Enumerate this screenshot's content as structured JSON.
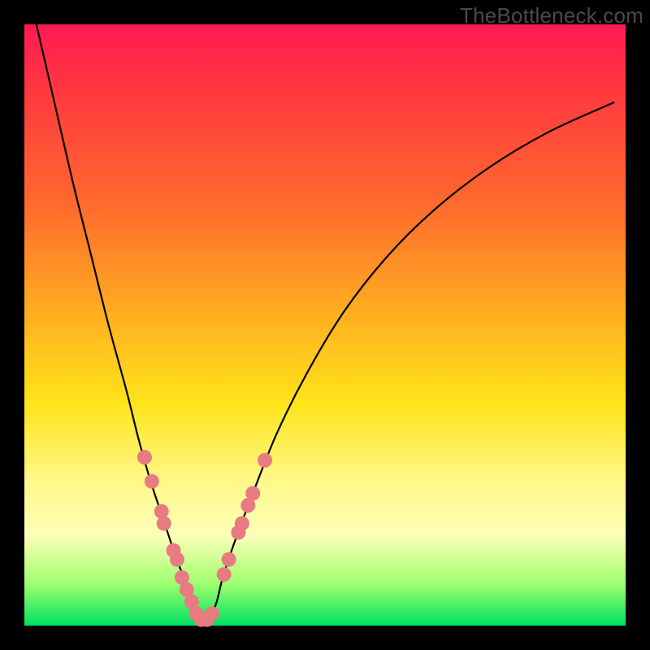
{
  "watermark": "TheBottleneck.com",
  "chart_data": {
    "type": "line",
    "title": "",
    "xlabel": "",
    "ylabel": "",
    "xlim": [
      0,
      100
    ],
    "ylim": [
      0,
      100
    ],
    "grid": false,
    "legend": false,
    "series": [
      {
        "name": "bottleneck-curve",
        "x": [
          2,
          5,
          8,
          11,
          14,
          17,
          19,
          21,
          23,
          25,
          26.5,
          28,
          29,
          30,
          31,
          32,
          33,
          35,
          38,
          42,
          47,
          53,
          60,
          68,
          77,
          87,
          98
        ],
        "y": [
          100,
          87,
          74,
          62,
          50,
          39,
          31,
          24,
          18,
          12,
          8,
          4,
          1.5,
          0,
          1.5,
          4,
          8,
          14,
          22,
          32,
          42,
          52,
          61,
          69,
          76,
          82,
          87
        ]
      }
    ],
    "markers": {
      "name": "highlight-points",
      "color": "#e87a82",
      "radius_px": 9,
      "points": [
        {
          "x": 20.0,
          "y": 28.0
        },
        {
          "x": 21.2,
          "y": 24.0
        },
        {
          "x": 22.8,
          "y": 19.0
        },
        {
          "x": 23.2,
          "y": 17.0
        },
        {
          "x": 24.8,
          "y": 12.5
        },
        {
          "x": 25.4,
          "y": 11.0
        },
        {
          "x": 26.2,
          "y": 8.0
        },
        {
          "x": 27.0,
          "y": 6.0
        },
        {
          "x": 27.8,
          "y": 4.0
        },
        {
          "x": 28.6,
          "y": 2.0
        },
        {
          "x": 29.4,
          "y": 1.0
        },
        {
          "x": 30.4,
          "y": 1.0
        },
        {
          "x": 31.2,
          "y": 2.0
        },
        {
          "x": 33.2,
          "y": 8.5
        },
        {
          "x": 34.0,
          "y": 11.0
        },
        {
          "x": 35.6,
          "y": 15.5
        },
        {
          "x": 36.2,
          "y": 17.0
        },
        {
          "x": 37.2,
          "y": 20.0
        },
        {
          "x": 38.0,
          "y": 22.0
        },
        {
          "x": 40.0,
          "y": 27.5
        }
      ]
    }
  }
}
